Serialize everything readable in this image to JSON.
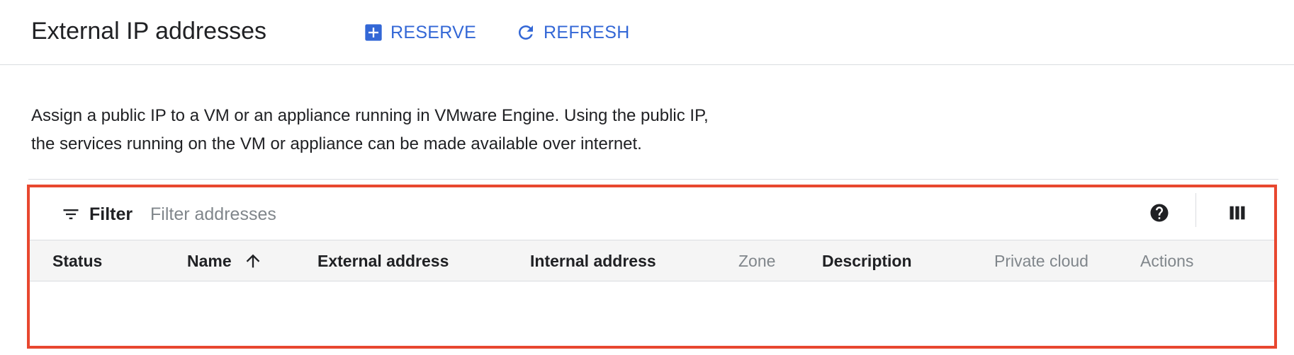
{
  "header": {
    "title": "External IP addresses",
    "reserve_label": "RESERVE",
    "refresh_label": "REFRESH"
  },
  "description": {
    "line1": "Assign a public IP to a VM or an appliance running in VMware Engine. Using the public IP,",
    "line2": "the services running on the VM or appliance can be made available over internet."
  },
  "toolbar": {
    "filter_label": "Filter",
    "filter_placeholder": "Filter addresses",
    "filter_value": ""
  },
  "table": {
    "columns": [
      {
        "label": "Status",
        "sortable": false
      },
      {
        "label": "Name",
        "sortable": true,
        "sort": "ascending"
      },
      {
        "label": "External address",
        "sortable": false
      },
      {
        "label": "Internal address",
        "sortable": false
      },
      {
        "label": "Zone",
        "sortable": false
      },
      {
        "label": "Description",
        "sortable": false
      },
      {
        "label": "Private cloud",
        "sortable": false
      },
      {
        "label": "Actions",
        "sortable": false
      }
    ],
    "rows": []
  },
  "icons": {
    "reserve": "add-box-icon",
    "refresh": "refresh-icon",
    "filter": "filter-list-icon",
    "help": "help-icon",
    "columns": "column-display-icon",
    "sort": "arrow-upward-icon"
  },
  "colors": {
    "accent": "#3367d6",
    "highlight_border": "#e8472f",
    "header_row_bg": "#f5f5f5",
    "muted_text": "#80868b"
  }
}
